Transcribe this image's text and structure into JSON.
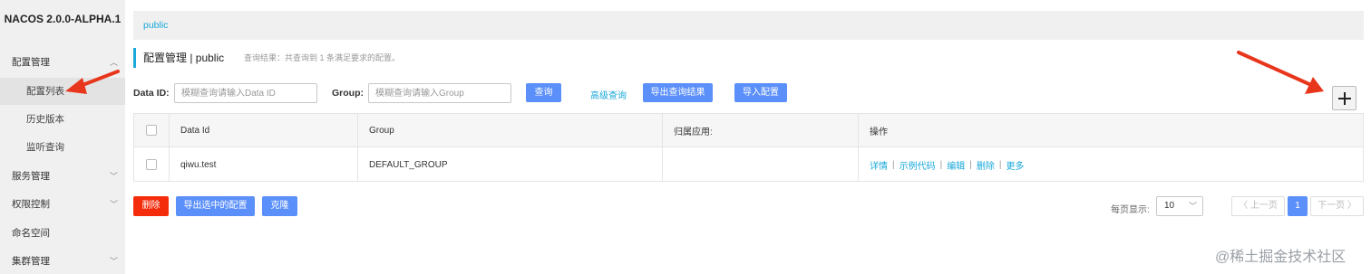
{
  "sidebar": {
    "brand": "NACOS 2.0.0-ALPHA.1",
    "items": [
      {
        "label": "配置管理",
        "expanded": true
      },
      {
        "label": "配置列表",
        "sub": true,
        "active": true
      },
      {
        "label": "历史版本",
        "sub": true
      },
      {
        "label": "监听查询",
        "sub": true
      },
      {
        "label": "服务管理",
        "expandable": true
      },
      {
        "label": "权限控制",
        "expandable": true
      },
      {
        "label": "命名空间"
      },
      {
        "label": "集群管理",
        "expandable": true
      }
    ]
  },
  "topbar": {
    "namespace": "public"
  },
  "header": {
    "title": "配置管理 | public",
    "result": "查询结果：共查询到 1 条满足要求的配置。"
  },
  "search": {
    "dataid_label": "Data ID:",
    "dataid_placeholder": "模糊查询请输入Data ID",
    "group_label": "Group:",
    "group_placeholder": "模糊查询请输入Group",
    "query_btn": "查询",
    "advanced_link": "高级查询",
    "export_btn": "导出查询结果",
    "import_btn": "导入配置"
  },
  "table": {
    "columns": [
      "Data Id",
      "Group",
      "归属应用:",
      "操作"
    ],
    "rows": [
      {
        "data_id": "qiwu.test",
        "group": "DEFAULT_GROUP",
        "app": "",
        "ops": [
          "详情",
          "示例代码",
          "编辑",
          "删除",
          "更多"
        ]
      }
    ]
  },
  "footer": {
    "delete_btn": "删除",
    "export_selected_btn": "导出选中的配置",
    "clone_btn": "克隆",
    "per_page_label": "每页显示:",
    "per_page_value": "10",
    "prev": "〈 上一页",
    "page": "1",
    "next": "下一页 〉"
  },
  "watermark": "@稀土掘金技术社区",
  "colors": {
    "accent": "#19a8d9",
    "primary": "#5b8ff9",
    "danger": "#f52c0b",
    "arrow": "#e8361c"
  }
}
